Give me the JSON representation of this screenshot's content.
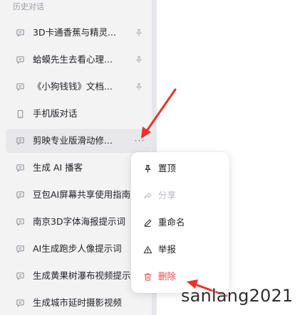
{
  "sidebar": {
    "section_title": "历史对话",
    "items": [
      {
        "label": "3D卡通香蕉与精灵...",
        "icon": "chat-bubble-icon",
        "trailing": "pin-icon"
      },
      {
        "label": "蛤蟆先生去看心理...",
        "icon": "chat-bubble-icon",
        "trailing": "pin-icon"
      },
      {
        "label": "《小狗钱钱》文档...",
        "icon": "chat-bubble-icon",
        "trailing": "pin-icon"
      },
      {
        "label": "手机版对话",
        "icon": "phone-icon",
        "trailing": ""
      },
      {
        "label": "剪映专业版滑动修...",
        "icon": "chat-bubble-icon",
        "trailing": "more-icon"
      },
      {
        "label": "生成 AI 播客",
        "icon": "chat-bubble-icon",
        "trailing": ""
      },
      {
        "label": "豆包AI屏幕共享使用指南",
        "icon": "chat-bubble-icon",
        "trailing": ""
      },
      {
        "label": "南京3D字体海报提示词",
        "icon": "chat-bubble-icon",
        "trailing": ""
      },
      {
        "label": "AI生成跑步人像提示词",
        "icon": "chat-bubble-icon",
        "trailing": ""
      },
      {
        "label": "生成黄果树瀑布视频提示",
        "icon": "chat-bubble-icon",
        "trailing": ""
      },
      {
        "label": "生成城市延时摄影视频",
        "icon": "chat-bubble-icon",
        "trailing": ""
      }
    ],
    "more_glyph": "···"
  },
  "context_menu": {
    "items": [
      {
        "label": "置顶",
        "icon": "pin-icon",
        "state": "normal"
      },
      {
        "label": "分享",
        "icon": "share-icon",
        "state": "disabled"
      },
      {
        "label": "重命名",
        "icon": "pencil-icon",
        "state": "normal"
      },
      {
        "label": "举报",
        "icon": "warning-icon",
        "state": "normal"
      },
      {
        "label": "删除",
        "icon": "trash-icon",
        "state": "danger"
      }
    ]
  },
  "colors": {
    "sidebar_bg": "#f3f3f4",
    "danger": "#e5484d",
    "annotation_arrow": "#e8322b"
  },
  "watermark": "sanlang2021"
}
